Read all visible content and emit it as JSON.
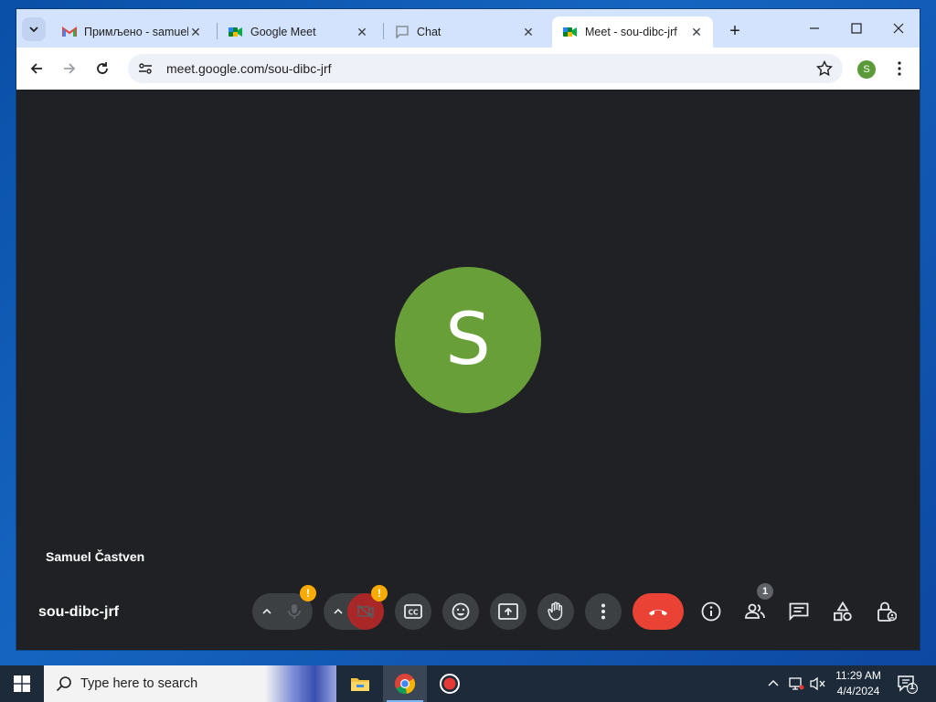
{
  "browser": {
    "tabs": [
      {
        "title": "Примљено - samuel",
        "favicon": "gmail-icon",
        "active": false
      },
      {
        "title": "Google Meet",
        "favicon": "meet-icon",
        "active": false
      },
      {
        "title": "Chat",
        "favicon": "chat-icon",
        "active": false
      },
      {
        "title": "Meet - sou-dibc-jrf",
        "favicon": "meet-icon",
        "active": true
      }
    ],
    "url": "meet.google.com/sou-dibc-jrf",
    "profile_initial": "S"
  },
  "meet": {
    "avatar_initial": "S",
    "avatar_color": "#689f38",
    "participant_name": "Samuel Častven",
    "meeting_code": "sou-dibc-jrf",
    "mic_badge": "!",
    "cam_badge": "!",
    "people_count": "1",
    "end_call_color": "#ea4335"
  },
  "taskbar": {
    "search_placeholder": "Type here to search",
    "time": "11:29 AM",
    "date": "4/4/2024",
    "notification_count": "1"
  }
}
